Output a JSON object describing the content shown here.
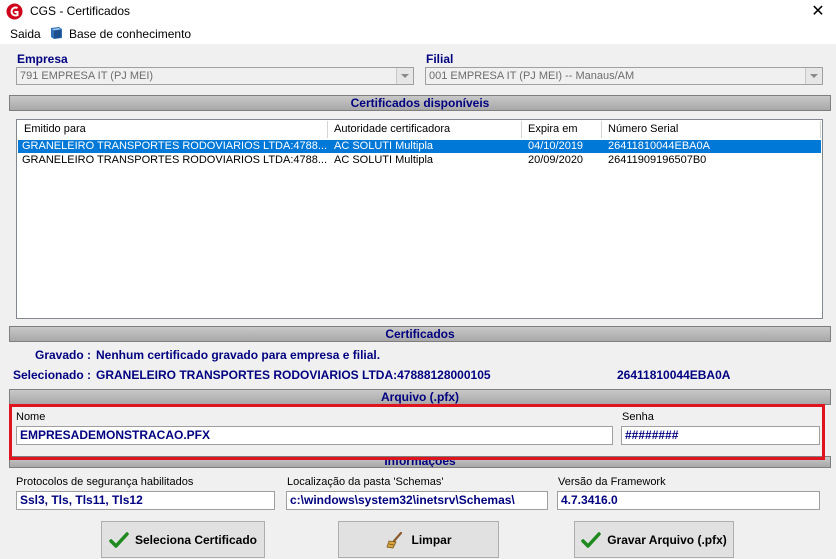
{
  "window": {
    "title": "CGS - Certificados",
    "close_glyph": "✕",
    "logo_icon": "cgs-logo-icon",
    "close_icon": "close-icon"
  },
  "menu": {
    "items": [
      {
        "label": "Saida"
      },
      {
        "label": "Base de conhecimento",
        "icon": "book-icon"
      }
    ]
  },
  "empresa": {
    "label": "Empresa",
    "value": "791 EMPRESA IT (PJ MEI)"
  },
  "filial": {
    "label": "Filial",
    "value": "001 EMPRESA IT (PJ MEI) -- Manaus/AM"
  },
  "certificados_disponiveis": {
    "title": "Certificados disponíveis",
    "columns": [
      "Emitido para",
      "Autoridade certificadora",
      "Expira em",
      "Número Serial"
    ],
    "rows": [
      {
        "emitido": "GRANELEIRO TRANSPORTES RODOVIARIOS LTDA:4788...",
        "autoridade": "AC SOLUTI Multipla",
        "expira": "04/10/2019",
        "serial": "26411810044EBA0A",
        "selected": true
      },
      {
        "emitido": "GRANELEIRO TRANSPORTES RODOVIARIOS LTDA:4788...",
        "autoridade": "AC SOLUTI Multipla",
        "expira": "20/09/2020",
        "serial": "26411909196507B0",
        "selected": false
      }
    ]
  },
  "certificados": {
    "title": "Certificados",
    "gravado_label": "Gravado :",
    "gravado_value": "Nenhum certificado gravado para empresa e filial.",
    "selecionado_label": "Selecionado :",
    "selecionado_value": "GRANELEIRO TRANSPORTES RODOVIARIOS LTDA:47888128000105",
    "selecionado_serial": "26411810044EBA0A"
  },
  "arquivo": {
    "title": "Arquivo (.pfx)",
    "nome_label": "Nome",
    "nome_value": "EMPRESADEMONSTRACAO.PFX",
    "senha_label": "Senha",
    "senha_value": "########"
  },
  "informacoes": {
    "title": "Informações",
    "protocolos_label": "Protocolos de segurança habilitados",
    "protocolos_value": "Ssl3, Tls, Tls11, Tls12",
    "schemas_label": "Localização da pasta 'Schemas'",
    "schemas_value": "c:\\windows\\system32\\inetsrv\\Schemas\\",
    "framework_label": "Versão da Framework",
    "framework_value": "4.7.3416.0"
  },
  "buttons": {
    "seleciona": {
      "label": "Seleciona Certificado",
      "icon": "checkmark-icon"
    },
    "limpar": {
      "label": "Limpar",
      "icon": "broom-icon"
    },
    "gravar": {
      "label": "Gravar Arquivo (.pfx)",
      "icon": "checkmark-icon"
    }
  },
  "colors": {
    "accent_text": "#000080",
    "selection": "#0078d7",
    "highlight_frame": "#e0141e",
    "check_green": "#1f8a1f"
  }
}
